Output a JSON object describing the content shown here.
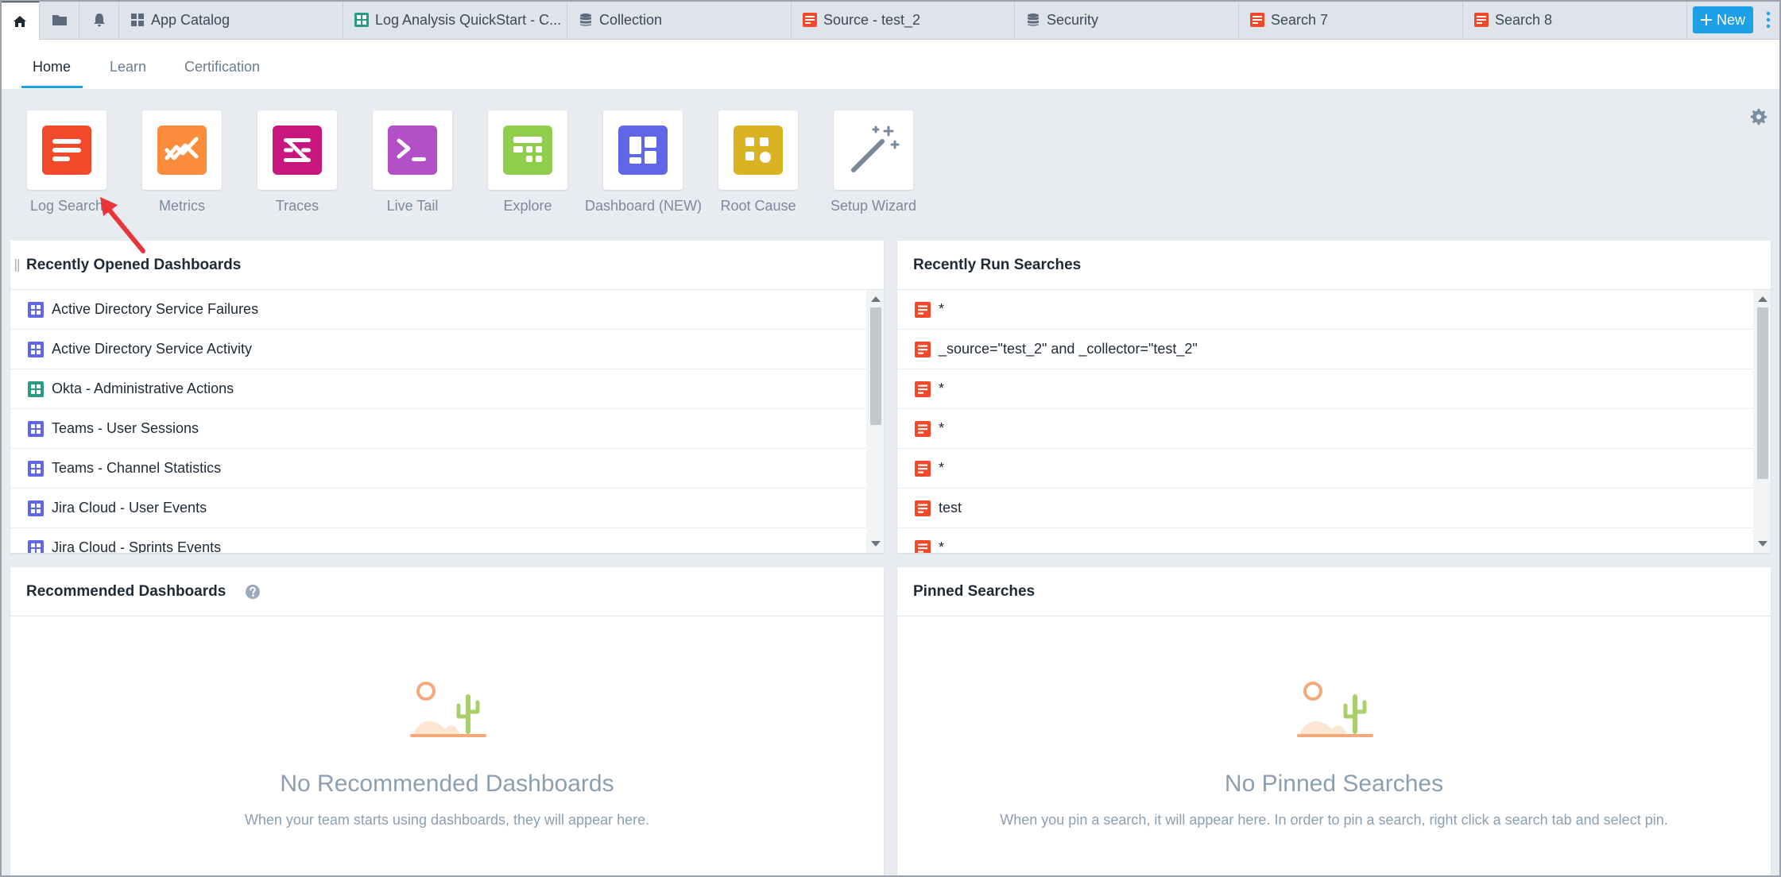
{
  "tabs": [
    {
      "label": "App Catalog",
      "icon": "grid-icon"
    },
    {
      "label": "Log Analysis QuickStart - C...",
      "icon": "dashboard-icon"
    },
    {
      "label": "Collection",
      "icon": "database-icon"
    },
    {
      "label": "Source - test_2",
      "icon": "log-search-icon"
    },
    {
      "label": "Security",
      "icon": "database-icon"
    },
    {
      "label": "Search 7",
      "icon": "log-search-icon"
    },
    {
      "label": "Search 8",
      "icon": "log-search-icon"
    }
  ],
  "new_button": {
    "label": "New"
  },
  "subnav": {
    "home": "Home",
    "learn": "Learn",
    "certification": "Certification"
  },
  "apps": [
    {
      "label": "Log Search",
      "color": "#f2492a"
    },
    {
      "label": "Metrics",
      "color": "#fb8c3c"
    },
    {
      "label": "Traces",
      "color": "#c9157e"
    },
    {
      "label": "Live Tail",
      "color": "#b350c8"
    },
    {
      "label": "Explore",
      "color": "#8fcd4a"
    },
    {
      "label": "Dashboard (NEW)",
      "color": "#6066e8"
    },
    {
      "label": "Root Cause",
      "color": "#d9b322"
    },
    {
      "label": "Setup Wizard",
      "color": "#7a8a9c"
    }
  ],
  "recent_dashboards": {
    "title": "Recently Opened Dashboards",
    "items": [
      {
        "label": "Active Directory Service Failures",
        "color": "#6066e8"
      },
      {
        "label": "Active Directory Service Activity",
        "color": "#6066e8"
      },
      {
        "label": "Okta - Administrative Actions",
        "color": "#2a9a84"
      },
      {
        "label": "Teams - User Sessions",
        "color": "#6066e8"
      },
      {
        "label": "Teams - Channel Statistics",
        "color": "#6066e8"
      },
      {
        "label": "Jira Cloud - User Events",
        "color": "#6066e8"
      },
      {
        "label": "Jira Cloud - Sprints Events",
        "color": "#6066e8"
      }
    ]
  },
  "recent_searches": {
    "title": "Recently Run Searches",
    "items": [
      {
        "label": "*"
      },
      {
        "label": "_source=\"test_2\" and _collector=\"test_2\""
      },
      {
        "label": "*"
      },
      {
        "label": "*"
      },
      {
        "label": "*"
      },
      {
        "label": "test"
      },
      {
        "label": "*"
      }
    ]
  },
  "recommended": {
    "title": "Recommended Dashboards",
    "empty_title": "No Recommended Dashboards",
    "empty_desc": "When your team starts using dashboards, they will appear here."
  },
  "pinned": {
    "title": "Pinned Searches",
    "empty_title": "No Pinned Searches",
    "empty_desc": "When you pin a search, it will appear here. In order to pin a search, right click a search tab and select pin."
  }
}
